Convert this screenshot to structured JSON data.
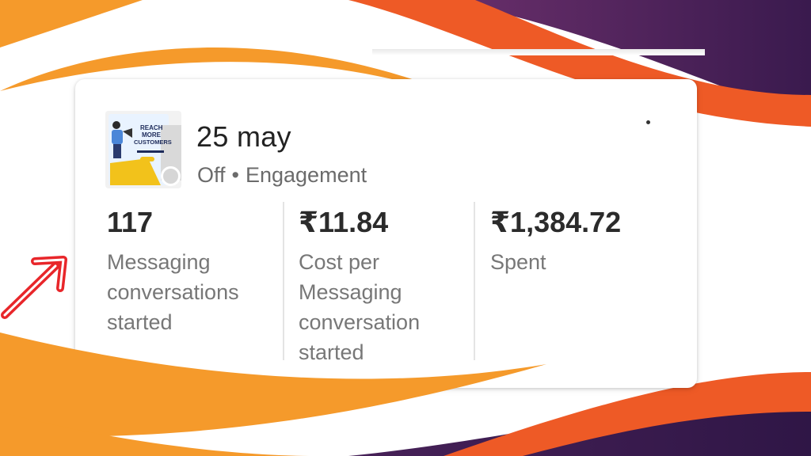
{
  "ad": {
    "title": "25 may",
    "status": "Off",
    "separator": "•",
    "objective": "Engagement",
    "thumbnail": {
      "line1": "REACH",
      "line2": "MORE",
      "line3": "CUSTOMERS"
    }
  },
  "metrics": [
    {
      "value": "117",
      "label": "Messaging conversations started"
    },
    {
      "value": "₹11.84",
      "label": "Cost per Messaging conversation started"
    },
    {
      "value": "₹1,384.72",
      "label": "Spent"
    }
  ],
  "colors": {
    "orange": "#F59A2B",
    "red_orange": "#EE5A26",
    "purple": "#4A2460",
    "arrow": "#E8262A"
  }
}
